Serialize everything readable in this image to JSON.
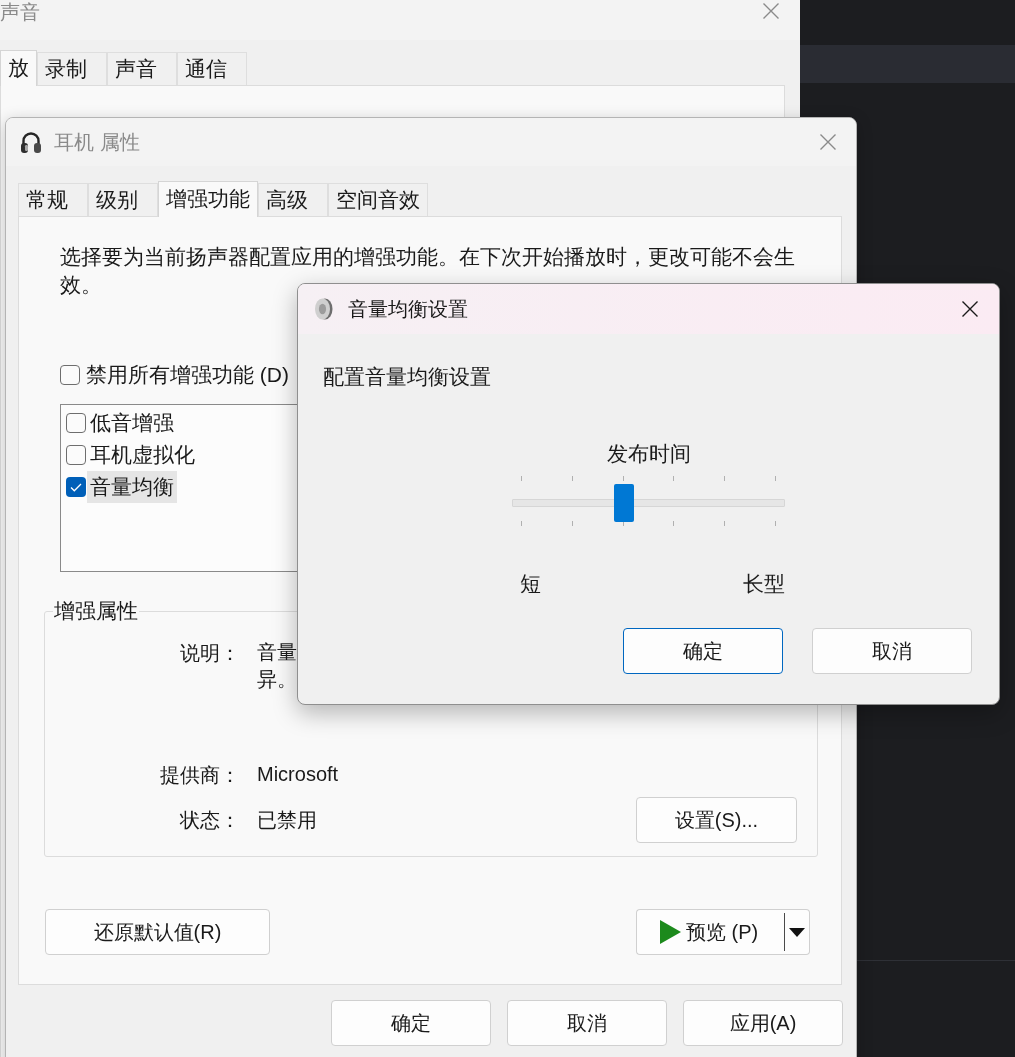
{
  "background_window": {
    "title": "声音",
    "active": false,
    "tabs": [
      {
        "label": "放",
        "selected": true
      },
      {
        "label": "录制",
        "selected": false
      },
      {
        "label": "声音",
        "selected": false
      },
      {
        "label": "通信",
        "selected": false
      }
    ]
  },
  "properties_window": {
    "title": "耳机 属性",
    "active": false,
    "tabs": [
      {
        "label": "常规",
        "selected": false
      },
      {
        "label": "级别",
        "selected": false
      },
      {
        "label": "增强功能",
        "selected": true
      },
      {
        "label": "高级",
        "selected": false
      },
      {
        "label": "空间音效",
        "selected": false
      }
    ],
    "intro": "选择要为当前扬声器配置应用的增强功能。在下次开始播放时，更改可能不会生效。",
    "disable_all": {
      "label": "禁用所有增强功能 (D)",
      "checked": false
    },
    "enhancements": [
      {
        "label": "低音增强",
        "checked": false,
        "selected": false
      },
      {
        "label": "耳机虚拟化",
        "checked": false,
        "selected": false
      },
      {
        "label": "音量均衡",
        "checked": true,
        "selected": true
      }
    ],
    "properties_group": {
      "title": "增强属性",
      "rows": [
        {
          "label": "说明：",
          "lines": [
            "音量",
            "异。"
          ]
        },
        {
          "label": "提供商：",
          "lines": [
            "Microsoft"
          ]
        },
        {
          "label": "状态：",
          "lines": [
            "已禁用"
          ],
          "button": {
            "label": "设置(S)..."
          }
        }
      ]
    },
    "restore_button": {
      "label": "还原默认值(R)"
    },
    "preview_button": {
      "label": "预览 (P)"
    },
    "buttons": [
      {
        "label": "确定"
      },
      {
        "label": "取消"
      },
      {
        "label": "应用(A)"
      }
    ]
  },
  "dialog": {
    "title": "音量均衡设置",
    "active": true,
    "heading": "配置音量均衡设置",
    "slider": {
      "label": "发布时间",
      "level": 0.4,
      "min_label": "短",
      "max_label": "长型"
    },
    "buttons": [
      {
        "label": "确定",
        "default": true
      },
      {
        "label": "取消",
        "default": false
      }
    ]
  }
}
